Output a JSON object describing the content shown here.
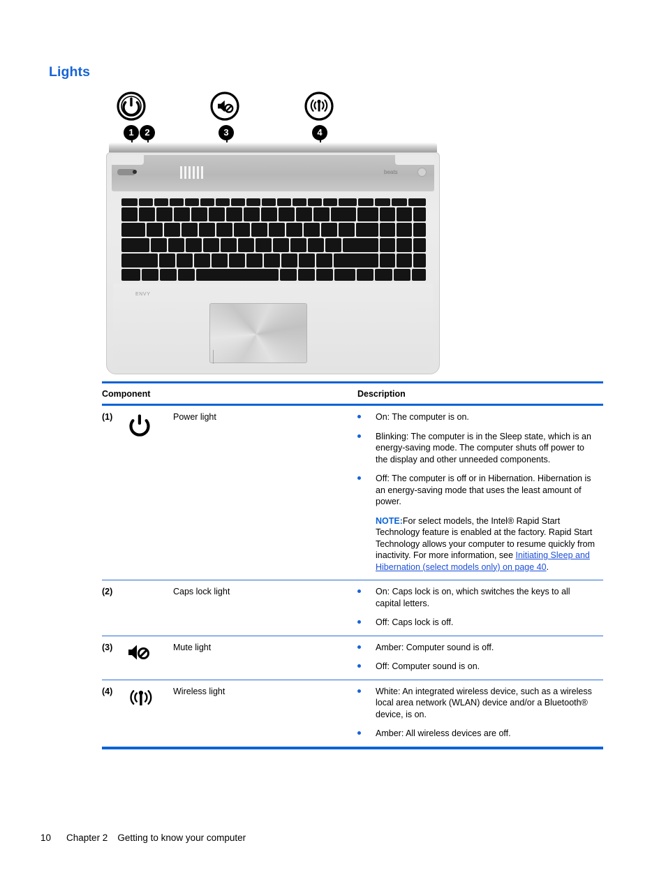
{
  "page": {
    "title": "Lights",
    "title_color": "#1763d6",
    "accent_color": "#0b63d6",
    "bullet_color": "#1763d6",
    "link_color": "#1c4fd8"
  },
  "illustration": {
    "alt": "Top view of laptop keyboard showing light locations",
    "callouts": [
      {
        "number": "1",
        "icon": "power-icon",
        "label": "Power light"
      },
      {
        "number": "2",
        "icon": "caps-lock-light-icon",
        "label": "Caps lock light"
      },
      {
        "number": "3",
        "icon": "mute-icon",
        "label": "Mute light"
      },
      {
        "number": "4",
        "icon": "wireless-icon",
        "label": "Wireless light"
      }
    ],
    "brand_text": "ENVY",
    "audio_brand_text": "beats"
  },
  "table": {
    "headers": {
      "component": "Component",
      "description": "Description"
    },
    "rows": [
      {
        "number": "(1)",
        "icon": "power-icon",
        "label": "Power light",
        "bullets": [
          "On: The computer is on.",
          "Blinking: The computer is in the Sleep state, which is an energy-saving mode. The computer shuts off power to the display and other unneeded components.",
          "Off: The computer is off or in Hibernation. Hibernation is an energy-saving mode that uses the least amount of power."
        ],
        "note": {
          "label": "NOTE:",
          "text_before_link": "For select models, the Intel® Rapid Start Technology feature is enabled at the factory. Rapid Start Technology allows your computer to resume quickly from inactivity. For more information, see ",
          "link_text": "Initiating Sleep and Hibernation (select models only) on page 40",
          "text_after_link": "."
        }
      },
      {
        "number": "(2)",
        "icon": "none",
        "label": "Caps lock light",
        "bullets": [
          "On: Caps lock is on, which switches the keys to all capital letters.",
          "Off: Caps lock is off."
        ],
        "note": null
      },
      {
        "number": "(3)",
        "icon": "mute-icon",
        "label": "Mute light",
        "bullets": [
          "Amber: Computer sound is off.",
          "Off: Computer sound is on."
        ],
        "note": null
      },
      {
        "number": "(4)",
        "icon": "wireless-icon",
        "label": "Wireless light",
        "bullets": [
          "White: An integrated wireless device, such as a wireless local area network (WLAN) device and/or a Bluetooth® device, is on.",
          "Amber: All wireless devices are off."
        ],
        "note": null
      }
    ]
  },
  "footer": {
    "page_number": "10",
    "chapter": "Chapter 2",
    "chapter_title": "Getting to know your computer"
  }
}
